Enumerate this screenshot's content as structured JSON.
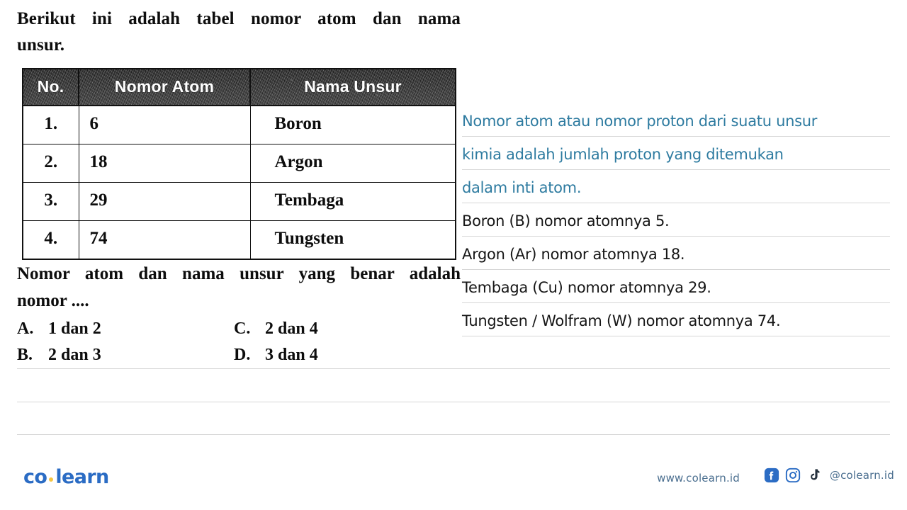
{
  "question": {
    "intro_line1": "Berikut ini adalah tabel nomor atom dan nama",
    "intro_line2": "unsur.",
    "stem_line1": "Nomor atom dan nama unsur yang benar adalah",
    "stem_line2": "nomor ....",
    "table": {
      "headers": [
        "No.",
        "Nomor Atom",
        "Nama Unsur"
      ],
      "rows": [
        {
          "no": "1.",
          "nomor_atom": "6",
          "nama_unsur": "Boron"
        },
        {
          "no": "2.",
          "nomor_atom": "18",
          "nama_unsur": "Argon"
        },
        {
          "no": "3.",
          "nomor_atom": "29",
          "nama_unsur": "Tembaga"
        },
        {
          "no": "4.",
          "nomor_atom": "74",
          "nama_unsur": "Tungsten"
        }
      ]
    },
    "options": [
      {
        "key": "A.",
        "text": "1 dan 2"
      },
      {
        "key": "C.",
        "text": "2 dan 4"
      },
      {
        "key": "B.",
        "text": "2 dan 3"
      },
      {
        "key": "D.",
        "text": "3 dan 4"
      }
    ]
  },
  "answer": {
    "lines": [
      {
        "text": "Nomor atom atau nomor proton dari suatu unsur",
        "color": "blue"
      },
      {
        "text": "kimia adalah jumlah proton yang ditemukan",
        "color": "blue"
      },
      {
        "text": "dalam inti atom.",
        "color": "blue"
      },
      {
        "text": "Boron (B) nomor atomnya 5.",
        "color": "black"
      },
      {
        "text": "Argon (Ar) nomor atomnya 18.",
        "color": "black"
      },
      {
        "text": "Tembaga (Cu) nomor atomnya 29.",
        "color": "black"
      },
      {
        "text": "Tungsten / Wolfram (W) nomor atomnya 74.",
        "color": "black"
      }
    ]
  },
  "footer": {
    "logo_first": "co",
    "logo_second": "learn",
    "website": "www.colearn.id",
    "handle": "@colearn.id",
    "icons": [
      "facebook-icon",
      "instagram-icon",
      "tiktok-icon"
    ]
  },
  "colors": {
    "accent_blue": "#2e7ba0",
    "logo_blue": "#2b6cc4",
    "logo_dot": "#f5c542",
    "footer_text": "#4a6e8f",
    "rule": "#d6d6d6",
    "table_header_bg": "#2a2a2a"
  }
}
